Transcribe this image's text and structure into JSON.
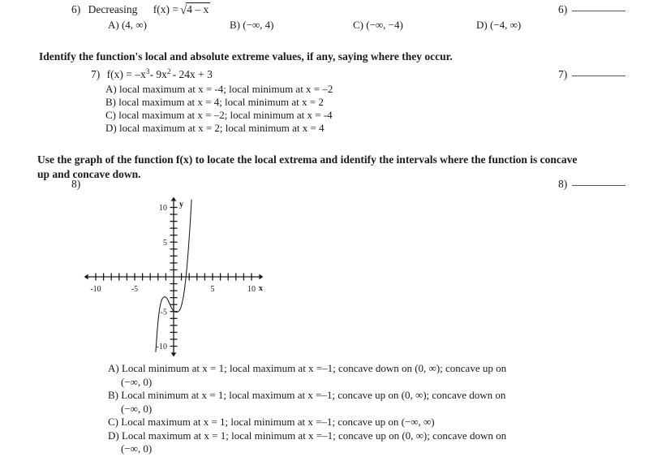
{
  "document": {
    "type": "math-worksheet-page"
  },
  "questions": [
    {
      "number": "6)",
      "right_marker": "6)",
      "stem_prefix": "Decreasing",
      "function_label": "f(x) =",
      "radicand": "4 – x",
      "options": [
        {
          "letter": "A)",
          "text": "(4, ∞)"
        },
        {
          "letter": "B)",
          "text": "(−∞, 4)"
        },
        {
          "letter": "C)",
          "text": "(−∞, −4)"
        },
        {
          "letter": "D)",
          "text": "(−4, ∞)"
        }
      ]
    },
    {
      "number": "7)",
      "right_marker": "7)",
      "instruction": "Identify the function's local and absolute extreme values, if any, saying where they occur.",
      "stem": "f(x) = −x3 - 9x2 - 24x + 3",
      "stem_parts": {
        "lead": "f(x) = –x",
        "exp1": "3",
        "mid": "- 9x",
        "exp2": "2",
        "tail": "- 24x + 3"
      },
      "options": [
        {
          "letter": "A)",
          "text": "local maximum at x = -4; local minimum at x = –2"
        },
        {
          "letter": "B)",
          "text": "local maximum at x = 4; local minimum at x = 2"
        },
        {
          "letter": "C)",
          "text": "local maximum at x = –2; local minimum at x = -4"
        },
        {
          "letter": "D)",
          "text": "local maximum at x = 2; local minimum at x = 4"
        }
      ]
    },
    {
      "number": "8)",
      "right_marker": "8)",
      "instruction_line1": "Use the graph of the function f(x) to locate the local extrema and identify the intervals where the function is concave",
      "instruction_line2": "up and concave down.",
      "options": [
        {
          "letter": "A)",
          "text": "Local minimum at x = 1; local maximum at x =–1; concave down on (0, ∞); concave up on",
          "cont": "(−∞, 0)"
        },
        {
          "letter": "B)",
          "text": "Local minimum at x = 1; local maximum at x =–1; concave up on (0, ∞); concave down on",
          "cont": "(−∞, 0)"
        },
        {
          "letter": "C)",
          "text": "Local maximum at x = 1; local minimum at x =–1; concave up on (−∞, ∞)",
          "cont": ""
        },
        {
          "letter": "D)",
          "text": "Local maximum at x = 1; local minimum at x =–1; concave up on (0, ∞); concave down on",
          "cont": "(−∞, 0)"
        }
      ]
    }
  ],
  "chart_data": {
    "type": "line",
    "title": "",
    "xlabel": "x",
    "ylabel": "y",
    "xlim": [
      -11.5,
      11.5
    ],
    "ylim": [
      -11.5,
      11.5
    ],
    "xticks": [
      -10,
      -9,
      -8,
      -7,
      -6,
      -5,
      -4,
      -3,
      -2,
      -1,
      1,
      2,
      3,
      4,
      5,
      6,
      7,
      8,
      9,
      10
    ],
    "yticks": [
      -10,
      -9,
      -8,
      -7,
      -6,
      -5,
      -4,
      -3,
      -2,
      -1,
      1,
      2,
      3,
      4,
      5,
      6,
      7,
      8,
      9,
      10
    ],
    "xtick_labels": [
      {
        "value": -10,
        "label": "-10"
      },
      {
        "value": -5,
        "label": "-5"
      },
      {
        "value": 5,
        "label": "5"
      },
      {
        "value": 10,
        "label": "10"
      }
    ],
    "ytick_labels": [
      {
        "value": 10,
        "label": "10"
      },
      {
        "value": 5,
        "label": "5"
      },
      {
        "value": -5,
        "label": "-5"
      },
      {
        "value": -10,
        "label": "-10"
      }
    ],
    "grid": false,
    "legend": null,
    "axis_arrows": true,
    "series": [
      {
        "name": "f(x)",
        "description": "cubic-like curve with local maximum near (-1, -3) and local minimum near (1, -5)",
        "points": [
          [
            -2.3,
            -10.8
          ],
          [
            -2.2,
            -9.2
          ],
          [
            -2.1,
            -7.7
          ],
          [
            -2.0,
            -6.4
          ],
          [
            -1.9,
            -5.4
          ],
          [
            -1.8,
            -4.6
          ],
          [
            -1.7,
            -4.0
          ],
          [
            -1.6,
            -3.55
          ],
          [
            -1.45,
            -3.15
          ],
          [
            -1.3,
            -2.95
          ],
          [
            -1.15,
            -2.88
          ],
          [
            -1.0,
            -2.95
          ],
          [
            -0.85,
            -3.12
          ],
          [
            -0.7,
            -3.42
          ],
          [
            -0.55,
            -3.8
          ],
          [
            -0.4,
            -4.18
          ],
          [
            -0.25,
            -4.52
          ],
          [
            -0.1,
            -4.78
          ],
          [
            0.05,
            -4.96
          ],
          [
            0.2,
            -5.06
          ],
          [
            0.4,
            -5.1
          ],
          [
            0.6,
            -5.02
          ],
          [
            0.8,
            -4.75
          ],
          [
            0.95,
            -4.35
          ],
          [
            1.1,
            -3.75
          ],
          [
            1.25,
            -2.9
          ],
          [
            1.4,
            -1.8
          ],
          [
            1.55,
            -0.4
          ],
          [
            1.7,
            1.3
          ],
          [
            1.85,
            3.3
          ],
          [
            2.0,
            5.6
          ],
          [
            2.15,
            8.2
          ],
          [
            2.3,
            11.1
          ]
        ]
      }
    ],
    "local_maximum": {
      "x": -1.15,
      "y": -2.88
    },
    "local_minimum": {
      "x": 0.4,
      "y": -5.1
    }
  }
}
